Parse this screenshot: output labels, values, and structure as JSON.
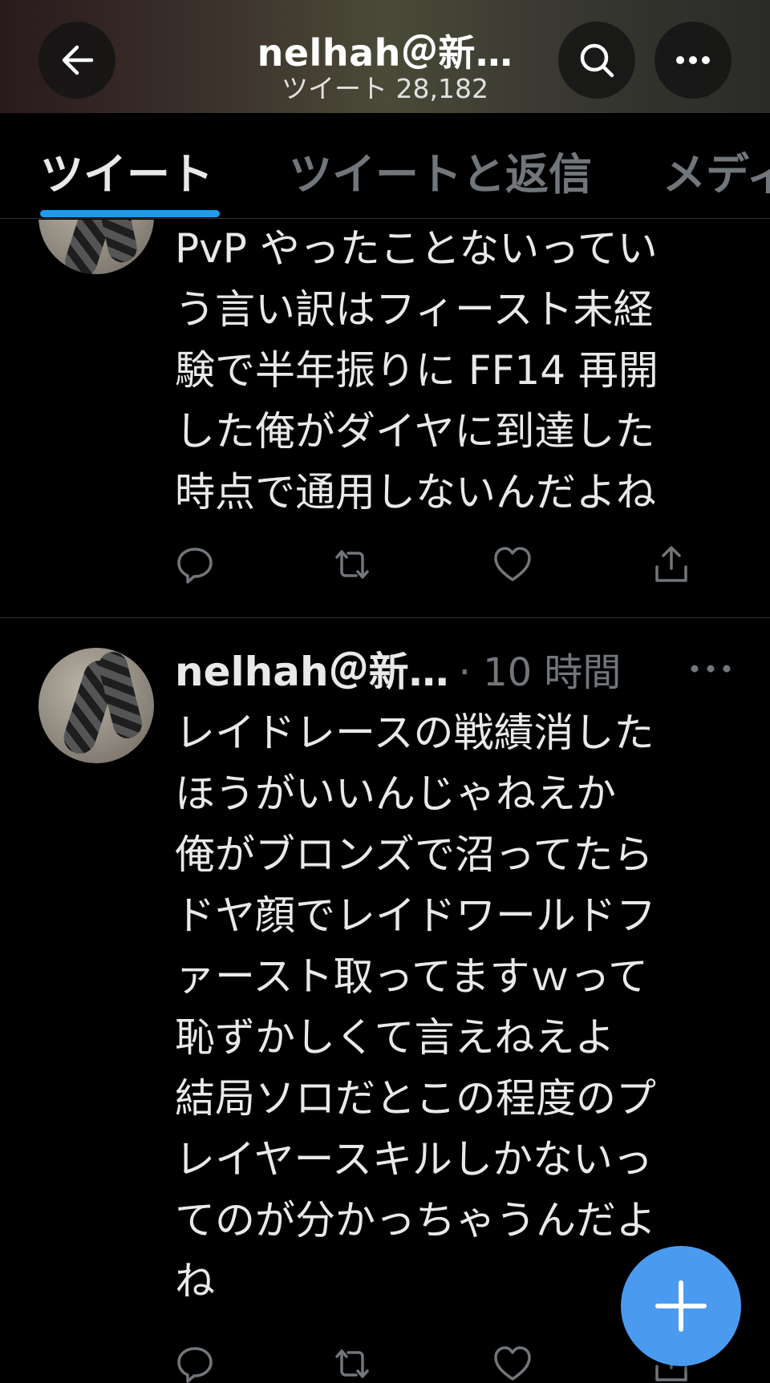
{
  "header": {
    "title": "nelhah＠新…",
    "subtitle": "ツイート 28,182"
  },
  "tabs": [
    {
      "label": "ツイート",
      "active": true
    },
    {
      "label": "ツイートと返信",
      "active": false
    },
    {
      "label": "メディ",
      "active": false
    }
  ],
  "tweets": [
    {
      "lines": [
        "PvP やったことないってい",
        "う言い訳はフィースト未経",
        "験で半年振りに FF14 再開",
        "した俺がダイヤに到達した",
        "時点で通用しないんだよね"
      ],
      "actions": [
        "reply-icon",
        "retweet-icon",
        "like-icon",
        "share-icon"
      ]
    },
    {
      "author": "nelhah＠新…",
      "time": "· 10 時間",
      "lines": [
        "レイドレースの戦績消した",
        "ほうがいいんじゃねえか",
        "俺がブロンズで沼ってたら",
        "ドヤ顔でレイドワールドフ",
        "ァースト取ってますｗって",
        "恥ずかしくて言えねえよ",
        "結局ソロだとこの程度のプ",
        "レイヤースキルしかないっ",
        "てのが分かっちゃうんだよ",
        "ね"
      ],
      "actions": [
        "reply-icon",
        "retweet-icon",
        "like-icon",
        "share-icon"
      ]
    }
  ],
  "colors": {
    "accent": "#1d9bf0",
    "fab": "#4a9bf0",
    "muted": "#71767b",
    "text": "#e7e9ea"
  }
}
